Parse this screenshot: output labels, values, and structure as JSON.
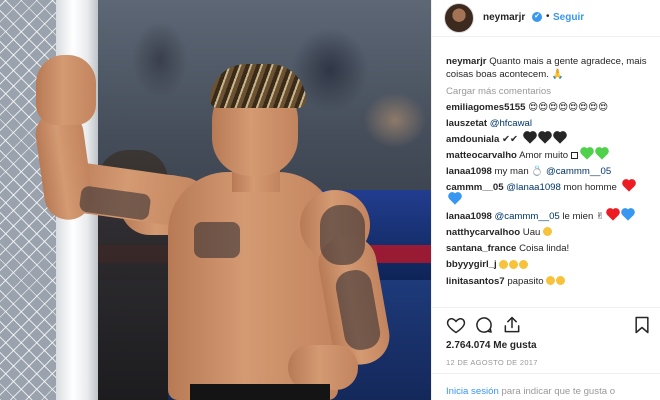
{
  "header": {
    "username": "neymarjr",
    "verified_mark": "✔",
    "separator": "•",
    "follow_label": "Seguir"
  },
  "caption": {
    "username": "neymarjr",
    "text": "Quanto mais a gente agradece, mais coisas boas acontecem. 🙏"
  },
  "load_more": "Cargar más comentarios",
  "comments": [
    {
      "user": "emiliagomes5155",
      "text": "😍😍😍😍😍😍😍😍"
    },
    {
      "user": "lauszetat",
      "mention": "@hfcawal"
    },
    {
      "user": "amdouniala",
      "text": "✔✔"
    },
    {
      "user": "matteocarvalho",
      "text": "Amor muito"
    },
    {
      "user": "lanaa1098",
      "text": "my man",
      "mention": "@cammm__05"
    },
    {
      "user": "cammm__05",
      "mention": "@lanaa1098",
      "text": "mon homme"
    },
    {
      "user": "lanaa1098",
      "mention": "@cammm__05",
      "text": "le mien"
    },
    {
      "user": "natthycarvalhoo",
      "text": "Uau"
    },
    {
      "user": "santana_france",
      "text": "Coisa linda!"
    },
    {
      "user": "bbyyygirl_j",
      "text": ""
    },
    {
      "user": "linitasantos7",
      "text": "papasito"
    }
  ],
  "actions": {
    "like_icon": "heart-outline-icon",
    "comment_icon": "speech-bubble-icon",
    "share_icon": "share-arrow-icon",
    "save_icon": "bookmark-icon"
  },
  "likes": "2.764.074 Me gusta",
  "date": "12 DE AGOSTO DE 2017",
  "login": {
    "link": "Inicia sesión",
    "text": "para indicar que te gusta o"
  },
  "colors": {
    "accent": "#3897f0",
    "text": "#262626",
    "muted": "#999999",
    "mention": "#003569",
    "heart_black": "#262626",
    "heart_green": "#4fd14b",
    "heart_red": "#ed1c24",
    "heart_blue": "#3897f0",
    "emoji_yellow": "#f7c23c"
  }
}
